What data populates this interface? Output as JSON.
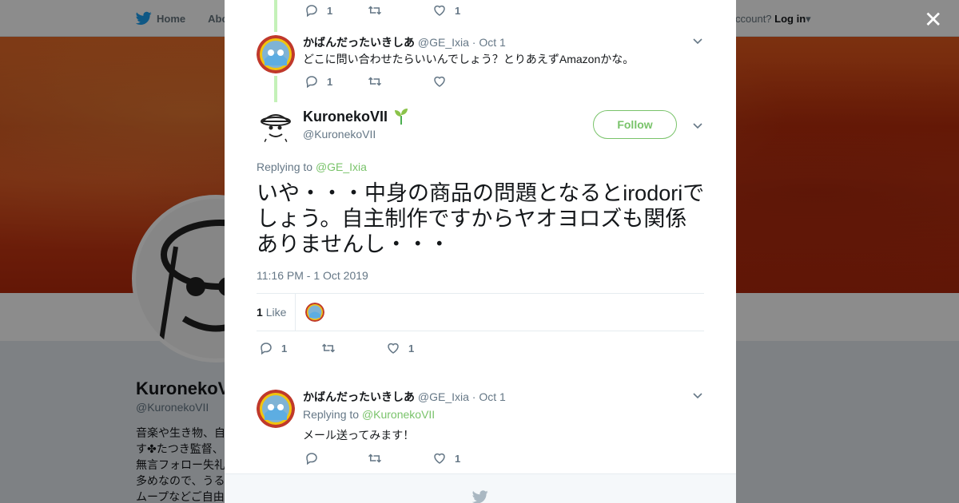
{
  "colors": {
    "accent": "#79c36a",
    "twitter_blue": "#1da1f2",
    "muted": "#657786"
  },
  "background_page": {
    "nav": {
      "home_label": "Home",
      "about_label": "Abo",
      "account_text": "ccount?",
      "login_label": "Log in"
    },
    "profile_name": "KuronekoV",
    "profile_handle": "@KuronekoVII",
    "bio_lines": [
      "音楽や生き物、自",
      "す✤たつき監督、",
      "無言フォロー失礼",
      "多めなので、うる",
      "ムープなどご自由"
    ]
  },
  "close_icon": "close-icon",
  "modal": {
    "prev_tweet_actions": {
      "reply_count": "1",
      "retweet_count": "",
      "like_count": "1"
    },
    "parent_tweet": {
      "name": "かばんだったいきしあ",
      "handle": "@GE_Ixia",
      "time": "· Oct 1",
      "text": "どこに問い合わせたらいいんでしょう？とりあえずAmazonかな。",
      "reply_count": "1",
      "like_count": ""
    },
    "main_tweet": {
      "name": "KuronekoVII",
      "handle": "@KuronekoVII",
      "follow_label": "Follow",
      "replying_prefix": "Replying to",
      "replying_to": "@GE_Ixia",
      "text": "いや・・・中身の商品の問題となるとirodoriでしょう。自主制作ですからヤオヨロズも関係ありませんし・・・",
      "timestamp": "11:16 PM - 1 Oct 2019",
      "likes_count": "1",
      "likes_label": "Like",
      "reply_count": "1",
      "like_count": "1"
    },
    "reply_tweet": {
      "name": "かばんだったいきしあ",
      "handle": "@GE_Ixia",
      "time": "· Oct 1",
      "replying_prefix": "Replying to",
      "replying_to": "@KuronekoVII",
      "text": "メール送ってみます！",
      "like_count": "1"
    }
  }
}
